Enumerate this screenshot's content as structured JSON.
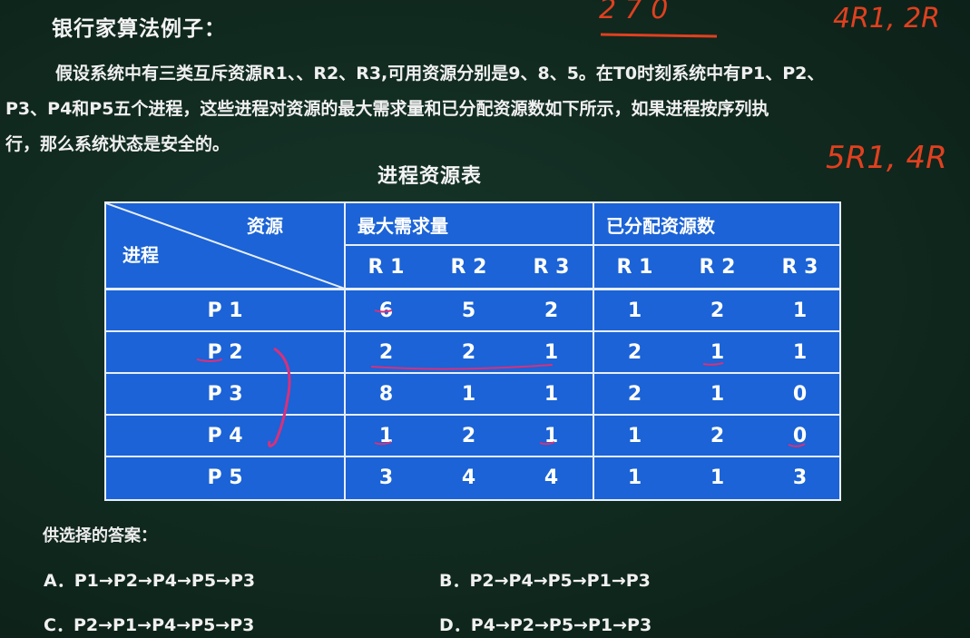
{
  "title": "银行家算法例子：",
  "paragraph": {
    "line1": "假设系统中有三类互斥资源R1、、R2、R3,可用资源分别是9、8、5。在T0时刻系统中有P1、P2、",
    "line2": "P3、P4和P5五个进程，这些进程对资源的最大需求量和已分配资源数如下所示，如果进程按序列执",
    "line3": "行，那么系统状态是安全的。"
  },
  "table": {
    "title": "进程资源表",
    "corner_resource": "资源",
    "corner_process": "进程",
    "group_max": "最大需求量",
    "group_alloc": "已分配资源数",
    "sub_headers": [
      "R 1",
      "R 2",
      "R 3",
      "R 1",
      "R 2",
      "R 3"
    ],
    "rows": [
      {
        "process": "P 1",
        "max": [
          "6",
          "5",
          "2"
        ],
        "alloc": [
          "1",
          "2",
          "1"
        ]
      },
      {
        "process": "P 2",
        "max": [
          "2",
          "2",
          "1"
        ],
        "alloc": [
          "2",
          "1",
          "1"
        ]
      },
      {
        "process": "P 3",
        "max": [
          "8",
          "1",
          "1"
        ],
        "alloc": [
          "2",
          "1",
          "0"
        ]
      },
      {
        "process": "P 4",
        "max": [
          "1",
          "2",
          "1"
        ],
        "alloc": [
          "1",
          "2",
          "0"
        ]
      },
      {
        "process": "P 5",
        "max": [
          "3",
          "4",
          "4"
        ],
        "alloc": [
          "1",
          "1",
          "3"
        ]
      }
    ]
  },
  "answers": {
    "label": "供选择的答案：",
    "options": [
      "A．P1→P2→P4→P5→P3",
      "B．P2→P4→P5→P1→P3",
      "C．P2→P1→P4→P5→P3",
      "D．P4→P2→P5→P1→P3"
    ]
  },
  "handwriting": {
    "top1": "2 7 0",
    "top2": "4R1, 2R",
    "mid": "5R1, 4R"
  },
  "colors": {
    "table_fill": "#1b63d6",
    "ink_red": "#e0401f",
    "annotation_pink": "#d8307a"
  }
}
